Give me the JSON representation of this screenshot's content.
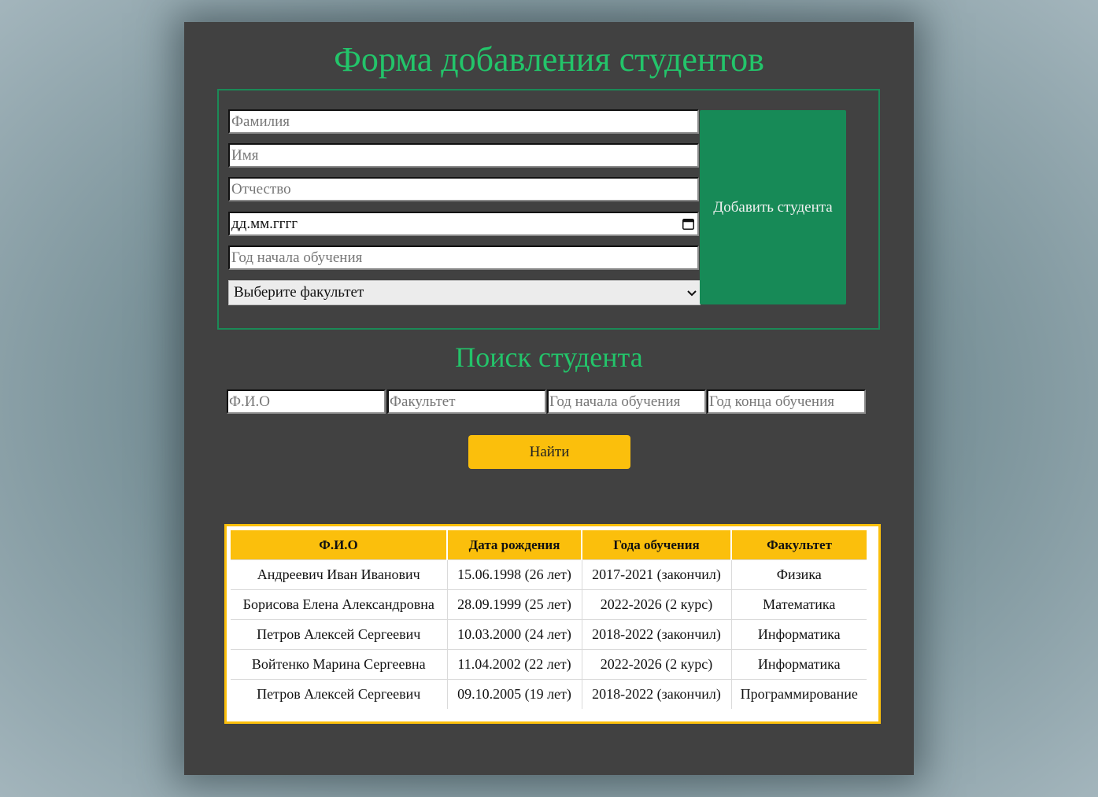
{
  "add_form": {
    "title": "Форма добавления студентов",
    "surname_placeholder": "Фамилия",
    "name_placeholder": "Имя",
    "patronymic_placeholder": "Отчество",
    "birthdate_placeholder": "дд.мм.гггг",
    "start_year_placeholder": "Год начала обучения",
    "faculty_select": "Выберите факультет",
    "add_button": "Добавить студента"
  },
  "search": {
    "title": "Поиск студента",
    "fio_placeholder": "Ф.И.О",
    "faculty_placeholder": "Факультет",
    "start_year_placeholder": "Год начала обучения",
    "end_year_placeholder": "Год конца обучения",
    "find_button": "Найти"
  },
  "table": {
    "headers": [
      "Ф.И.О",
      "Дата рождения",
      "Года обучения",
      "Факультет"
    ],
    "rows": [
      [
        "Андреевич Иван Иванович",
        "15.06.1998 (26 лет)",
        "2017-2021 (закончил)",
        "Физика"
      ],
      [
        "Борисова Елена Александровна",
        "28.09.1999 (25 лет)",
        "2022-2026 (2 курс)",
        "Математика"
      ],
      [
        "Петров Алексей Сергеевич",
        "10.03.2000 (24 лет)",
        "2018-2022 (закончил)",
        "Информатика"
      ],
      [
        "Войтенко Марина Сергеевна",
        "11.04.2002 (22 лет)",
        "2022-2026 (2 курс)",
        "Информатика"
      ],
      [
        "Петров Алексей Сергеевич",
        "09.10.2005 (19 лет)",
        "2018-2022 (закончил)",
        "Программирование"
      ]
    ]
  },
  "colors": {
    "panel_bg": "#414141",
    "accent_green": "#23c46a",
    "button_green": "#178a57",
    "accent_yellow": "#fbbf0c"
  },
  "icons": {
    "date_picker": "calendar-icon",
    "select_arrow": "chevron-down-icon"
  }
}
